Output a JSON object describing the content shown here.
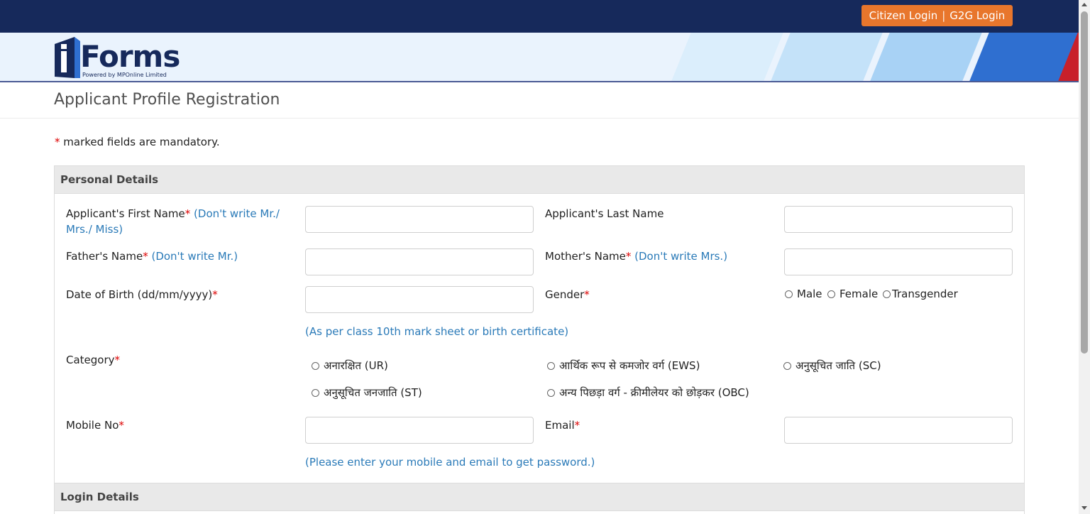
{
  "topbar": {
    "citizen_login": "Citizen Login",
    "separator": "|",
    "g2g_login": "G2G Login"
  },
  "logo": {
    "letter_i": "i",
    "text": "Forms",
    "subtitle": "Powered by MPOnline Limited"
  },
  "page_title": "Applicant Profile Registration",
  "mandatory_note": {
    "star": "*",
    "text": "marked fields are mandatory."
  },
  "sections": {
    "personal": "Personal Details",
    "login": "Login Details"
  },
  "fields": {
    "first_name": {
      "label": "Applicant's First Name",
      "star": "*",
      "hint": "(Don't write Mr./ Mrs./ Miss)",
      "value": ""
    },
    "last_name": {
      "label": "Applicant's Last Name",
      "value": ""
    },
    "father_name": {
      "label": "Father's Name",
      "star": "*",
      "hint": "(Don't write Mr.)",
      "value": ""
    },
    "mother_name": {
      "label": "Mother's Name",
      "star": "*",
      "hint": "(Don't write Mrs.)",
      "value": ""
    },
    "dob": {
      "label": "Date of Birth (dd/mm/yyyy)",
      "star": "*",
      "note": "(As per class 10th mark sheet or birth certificate)",
      "value": ""
    },
    "gender": {
      "label": "Gender",
      "star": "*",
      "options": [
        "Male",
        "Female",
        "Transgender"
      ]
    },
    "category": {
      "label": "Category",
      "star": "*",
      "options": [
        "अनारक्षित (UR)",
        "आर्थिक रूप से कमजोर वर्ग (EWS)",
        "अनुसूचित जाति (SC)",
        "अनुसूचित जनजाति (ST)",
        "अन्य पिछड़ा वर्ग - क्रीमीलेयर को छोड़कर (OBC)"
      ]
    },
    "mobile": {
      "label": "Mobile No",
      "star": "*",
      "note": "(Please enter your mobile and email to get password.)",
      "value": ""
    },
    "email": {
      "label": "Email",
      "star": "*",
      "value": ""
    }
  },
  "colors": {
    "topbar": "#16295b",
    "accent": "#e8762c",
    "hint": "#2a7ab8",
    "required": "#dd0000"
  }
}
